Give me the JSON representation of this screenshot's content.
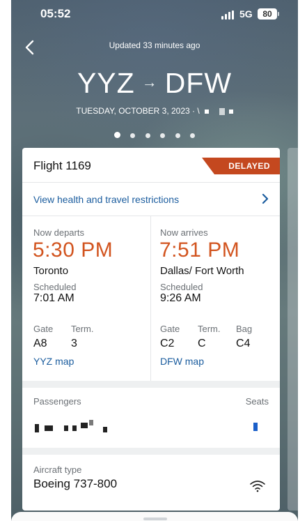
{
  "status_bar": {
    "time": "05:52",
    "network": "5G",
    "battery": "80"
  },
  "header": {
    "updated": "Updated 33 minutes ago",
    "origin": "YYZ",
    "arrow": "→",
    "destination": "DFW",
    "date": "TUESDAY, OCTOBER 3, 2023 · \\"
  },
  "pager": {
    "count": 6,
    "active": 0
  },
  "card": {
    "flight_title": "Flight 1169",
    "status_badge": "DELAYED",
    "restrictions_link": "View health and travel restrictions",
    "departure": {
      "label": "Now departs",
      "time": "5:30 PM",
      "city": "Toronto",
      "scheduled_label": "Scheduled",
      "scheduled_time": "7:01 AM",
      "gate_label": "Gate",
      "gate": "A8",
      "term_label": "Term.",
      "term": "3",
      "map_link": "YYZ map"
    },
    "arrival": {
      "label": "Now arrives",
      "time": "7:51 PM",
      "city": "Dallas/ Fort Worth",
      "scheduled_label": "Scheduled",
      "scheduled_time": "9:26 AM",
      "gate_label": "Gate",
      "gate": "C2",
      "term_label": "Term.",
      "term": "C",
      "bag_label": "Bag",
      "bag": "C4",
      "map_link": "DFW map"
    },
    "passengers_label": "Passengers",
    "seats_label": "Seats",
    "aircraft_label": "Aircraft type",
    "aircraft_type": "Boeing 737-800",
    "colors": {
      "accent_orange": "#d2541f",
      "badge_red": "#c4481f",
      "link_blue": "#1a5c9e"
    }
  }
}
